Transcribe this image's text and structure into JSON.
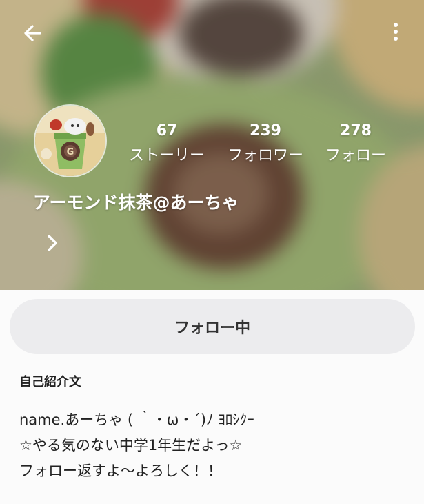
{
  "header": {
    "back_icon": "arrow-left-icon",
    "menu_icon": "more-vertical-icon"
  },
  "profile": {
    "avatar_icon": "profile-avatar",
    "name": "アーモンド抹茶@あーちゃ",
    "expand_icon": "chevron-right-icon",
    "stats": [
      {
        "value": "67",
        "label": "ストーリー"
      },
      {
        "value": "239",
        "label": "フォロワー"
      },
      {
        "value": "278",
        "label": "フォロー"
      }
    ]
  },
  "actions": {
    "follow_label": "フォロー中"
  },
  "bio": {
    "heading": "自己紹介文",
    "lines": [
      "name.あーちゃ ( ｀・ω・´)ﾉ ﾖﾛｼｸｰ",
      "☆やる気のない中学1年生だよっ☆",
      "フォロー返すよ〜よろしく！！"
    ]
  },
  "colors": {
    "button_bg": "#ececee",
    "text_primary": "#222222",
    "header_text": "#ffffff"
  }
}
